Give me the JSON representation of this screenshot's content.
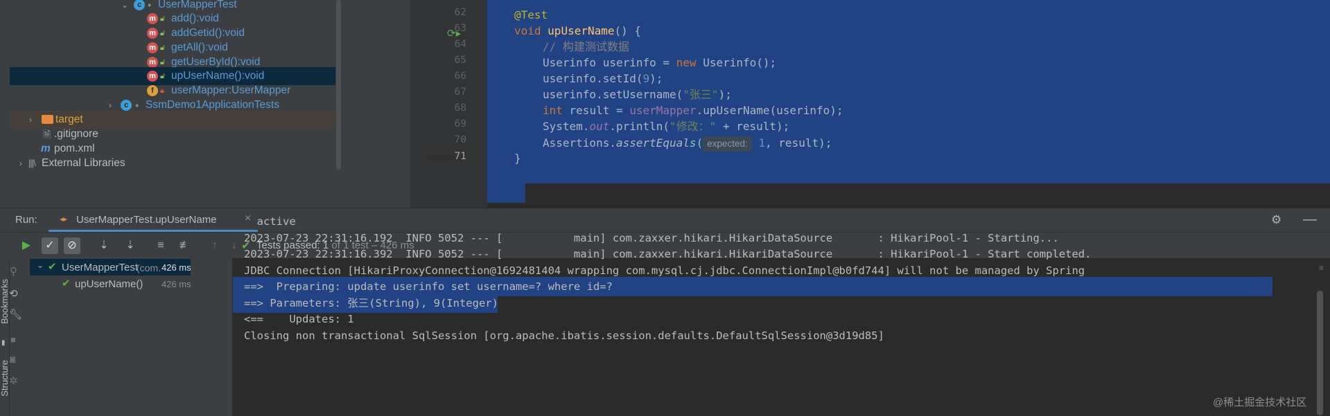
{
  "project_tree": {
    "items": [
      {
        "label": "UserMapperTest",
        "kind": "class"
      },
      {
        "label": "add():void",
        "kind": "method"
      },
      {
        "label": "addGetid():void",
        "kind": "method"
      },
      {
        "label": "getAll():void",
        "kind": "method"
      },
      {
        "label": "getUserById():void",
        "kind": "method"
      },
      {
        "label": "upUserName():void",
        "kind": "method",
        "selected": true
      },
      {
        "label": "userMapper:UserMapper",
        "kind": "field"
      },
      {
        "label": "SsmDemo1ApplicationTests",
        "kind": "class"
      },
      {
        "label": "target",
        "kind": "folder"
      },
      {
        "label": ".gitignore",
        "kind": "file"
      },
      {
        "label": "pom.xml",
        "kind": "maven"
      },
      {
        "label": "External Libraries",
        "kind": "libraries"
      }
    ]
  },
  "editor": {
    "line_numbers": [
      "62",
      "63",
      "64",
      "65",
      "66",
      "67",
      "68",
      "69",
      "70",
      "71"
    ],
    "code": {
      "l62": "@Test",
      "l63_kw": "void",
      "l63_name": "upUserName",
      "l63_rest": "() {",
      "l64": "// 构建测试数据",
      "l65_a": "Userinfo userinfo = ",
      "l65_kw": "new",
      "l65_b": " Userinfo();",
      "l66_a": "userinfo.setId(",
      "l66_num": "9",
      "l66_b": ");",
      "l67_a": "userinfo.setUsername(",
      "l67_str": "\"张三\"",
      "l67_b": ");",
      "l68_kw": "int",
      "l68_a": " result = ",
      "l68_fld": "userMapper",
      "l68_b": ".upUserName(userinfo);",
      "l69_a": "System.",
      "l69_fld": "out",
      "l69_b": ".println(",
      "l69_str": "\"修改：\"",
      "l69_c": " + result);",
      "l70_a": "Assertions.",
      "l70_it": "assertEquals",
      "l70_b": "(",
      "l70_hint": "expected:",
      "l70_num": "1",
      "l70_c": ", result);",
      "l71": "}"
    }
  },
  "run": {
    "label": "Run:",
    "tab": "UserMapperTest.upUserName",
    "status_prefix": "Tests passed:",
    "status_count": "1",
    "status_suffix": "of 1 test – 426 ms",
    "tests": [
      {
        "name": "UserMapperTest",
        "pkg": "(com.",
        "time": "426 ms"
      },
      {
        "name": "upUserName()",
        "time": "426 ms"
      }
    ],
    "side_labels": {
      "bookmarks": "Bookmarks",
      "structure": "Structure"
    }
  },
  "console": {
    "lines": [
      "  active",
      "2023-07-23 22:31:16.192  INFO 5052 --- [           main] com.zaxxer.hikari.HikariDataSource       : HikariPool-1 - Starting...",
      "2023-07-23 22:31:16.392  INFO 5052 --- [           main] com.zaxxer.hikari.HikariDataSource       : HikariPool-1 - Start completed.",
      "JDBC Connection [HikariProxyConnection@1692481404 wrapping com.mysql.cj.jdbc.ConnectionImpl@b0fd744] will not be managed by Spring",
      "==>  Preparing: update userinfo set username=? where id=?",
      "==> Parameters: 张三(String), 9(Integer)",
      "<==    Updates: 1",
      "Closing non transactional SqlSession [org.apache.ibatis.session.defaults.DefaultSqlSession@3d19d85]"
    ]
  },
  "watermark": "@稀土掘金技术社区"
}
